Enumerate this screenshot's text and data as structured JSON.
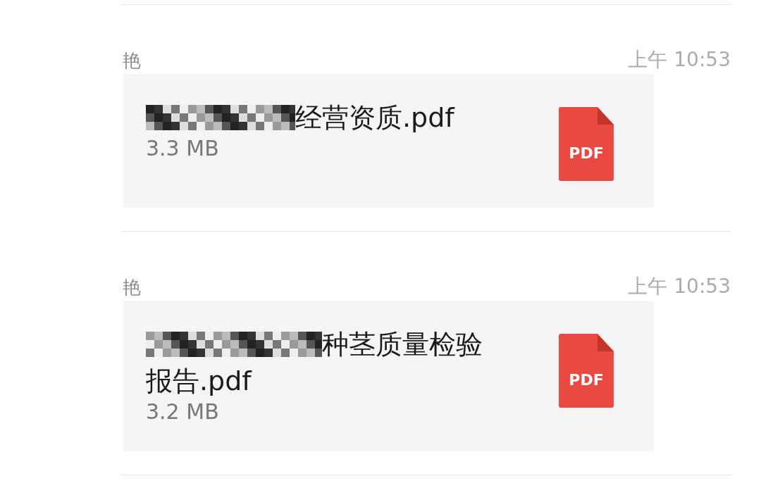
{
  "messages": [
    {
      "sender": "艳",
      "time": "上午 10:53",
      "file": {
        "name_lines": [
          "经营资质.pdf"
        ],
        "redacted": true,
        "size": "3.3 MB",
        "badge": "PDF"
      }
    },
    {
      "sender": "艳",
      "time": "上午 10:53",
      "file": {
        "name_lines": [
          "种茎质量检验",
          "报告.pdf"
        ],
        "redacted": true,
        "size": "3.2 MB",
        "badge": "PDF"
      }
    }
  ]
}
